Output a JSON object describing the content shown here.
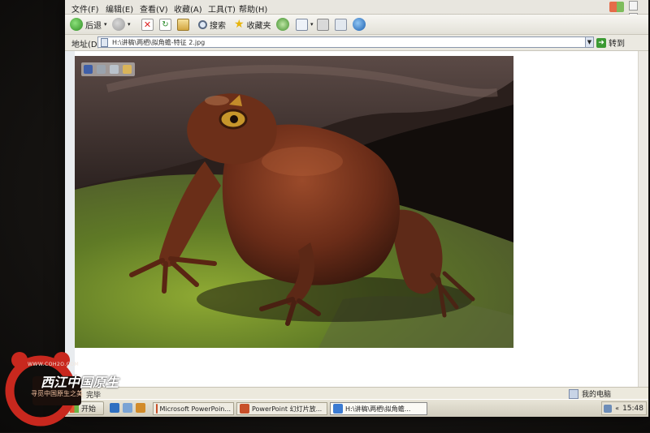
{
  "menu": {
    "items": [
      "文件(F)",
      "编辑(E)",
      "查看(V)",
      "收藏(A)",
      "工具(T)",
      "帮助(H)"
    ]
  },
  "toolbar": {
    "back_label": "后退",
    "search_label": "搜索",
    "favorites_label": "收藏夹"
  },
  "address": {
    "label": "地址(D)",
    "value": "H:\\讲稿\\两栖\\拟角蟾-特征 2.jpg",
    "go_label": "转到"
  },
  "status": {
    "text": "完毕",
    "zone": "我的电脑"
  },
  "taskbar": {
    "start_label": "开始",
    "tasks": [
      "Microsoft PowerPoin...",
      "PowerPoint 幻灯片放...",
      "H:\\讲稿\\两栖\\拟角蟾..."
    ],
    "clock": "15:48"
  },
  "watermark": {
    "url": "WWW.COH2O.COM",
    "title": "西江中国原生",
    "subtitle": "寻觅中国原生之美"
  },
  "icons": {
    "back": "back-arrow-icon",
    "forward": "forward-arrow-icon",
    "stop": "stop-icon",
    "refresh": "refresh-icon",
    "home": "home-icon",
    "search": "search-icon",
    "favorites": "star-icon",
    "history": "history-icon",
    "mail": "mail-icon",
    "print": "print-icon",
    "edit": "edit-icon",
    "ie": "ie-icon"
  }
}
